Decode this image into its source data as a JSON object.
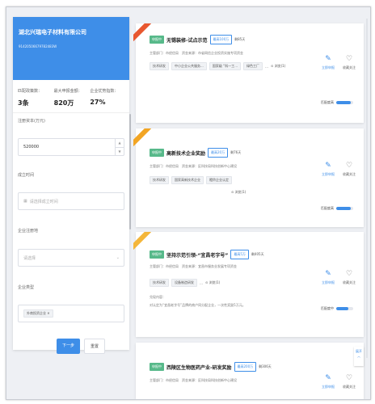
{
  "company": {
    "name": "湖北兴瑞电子材料有限公司",
    "code": "91420506679782483W"
  },
  "stats": [
    {
      "label": "匹配政策数：",
      "value": "3条"
    },
    {
      "label": "最大申报金额：",
      "value": "820万"
    },
    {
      "label": "企业优势指数：",
      "value": "27%"
    }
  ],
  "form": {
    "capital_label": "注册资本(万元)",
    "capital_value": "520000",
    "founded_label": "成立时间",
    "founded_placeholder": "请选择成立时间",
    "location_label": "企业注册地",
    "location_placeholder": "请选择",
    "type_label": "企业类型",
    "type_tag": "外商投资企业",
    "next_label": "下一步",
    "reset_label": "重置"
  },
  "cards": [
    {
      "ribbon": "",
      "status": "申报中",
      "title": "无锡装修-试点示范",
      "amount": "最高100万",
      "days": "剩85天",
      "meta1": "主管部门：市经信局　资金来源：市省网信企业投资实施专项资金",
      "tags": [
        "技术研发",
        "中小企业公共服务...",
        "国家级 “科一工...",
        "绿色工厂",
        "…"
      ],
      "extra": "浏览(1)",
      "actions": [
        "立即申报",
        "收藏关注"
      ],
      "match_label": "匹配度高",
      "match": 0.85
    },
    {
      "ribbon": "",
      "status": "申报中",
      "title": "高新技术企业奖励",
      "amount": "最高20万",
      "days": "剩76天",
      "meta1": "主管部门：市经信局　资金来源：区科技局科技创新中心建设",
      "tags": [
        "技术研发",
        "国家高新技术企业",
        "瞪羚企业认定"
      ],
      "extra": "浏览(1)",
      "actions": [
        "立即申报",
        "收藏关注"
      ],
      "match_label": "匹配度高",
      "match": 0.85
    },
    {
      "ribbon": "",
      "status": "申报中",
      "title": "坚持示范引领-“宜昌老字号”",
      "amount": "最高5万",
      "days": "剩405天",
      "meta1": "主管部门：市经信局　资金来源：宜昌市服务业发展专项资金",
      "tags": [
        "技术研发",
        "设备制造研发",
        "…"
      ],
      "extra": "浏览(1)",
      "detail_label": "兑现内容：",
      "detail": "对认定为“宜昌老字号”品牌的商户同分配企业，一次性奖励5万元。",
      "actions": [
        "立即申报",
        "收藏关注"
      ],
      "match_label": "匹配度中",
      "match": 0.7
    },
    {
      "ribbon": "",
      "status": "申报中",
      "title": "西陵区生物医药产业-研发奖励",
      "amount": "最高200万",
      "days": "剩306天",
      "meta1": "主管部门：市经信局　资金来源：区科技局科技创新中心建设",
      "actions": [
        "立即申报",
        "收藏关注"
      ]
    }
  ],
  "expand_label": "展开",
  "colors": {
    "primary": "#3e8ee8",
    "status": "#57b98a",
    "ribbon1": "#e8572f",
    "ribbon2": "#f2a524",
    "ribbon3": "#f4b63a"
  }
}
